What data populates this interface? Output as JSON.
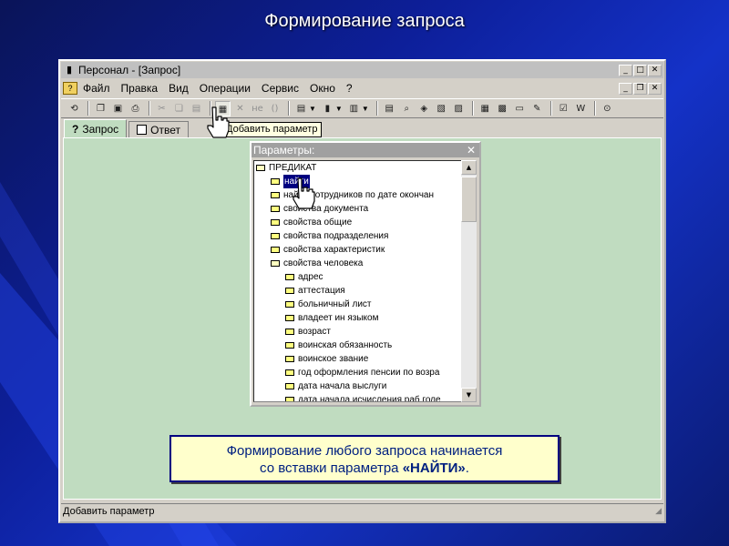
{
  "slide": {
    "title": "Формирование запроса"
  },
  "window": {
    "title": "Персонал - [Запрос]",
    "controls": {
      "minimize": "_",
      "maximize": "□",
      "close": "✕"
    },
    "mdi_controls": {
      "minimize": "_",
      "restore": "❐",
      "close": "✕"
    }
  },
  "menu": [
    "Файл",
    "Правка",
    "Вид",
    "Операции",
    "Сервис",
    "Окно",
    "?"
  ],
  "toolbar": {
    "tooltip": "Добавить параметр",
    "disabled_labels": {
      "ne": "не",
      "brackets": "()"
    }
  },
  "tabs": [
    {
      "label": "Запрос",
      "active": true,
      "icon": "question-icon"
    },
    {
      "label": "Ответ",
      "active": false,
      "icon": "checkbox-icon"
    }
  ],
  "params_dialog": {
    "title": "Параметры:",
    "close": "✕",
    "tree": [
      {
        "label": "ПРЕДИКАТ",
        "level": 0,
        "open": true
      },
      {
        "label": "найти",
        "level": 1,
        "selected": true
      },
      {
        "label": "найти сотрудников по дате окончан",
        "level": 1
      },
      {
        "label": "свойства документа",
        "level": 1
      },
      {
        "label": "свойства общие",
        "level": 1
      },
      {
        "label": "свойства подразделения",
        "level": 1
      },
      {
        "label": "свойства характеристик",
        "level": 1
      },
      {
        "label": "свойства человека",
        "level": 1,
        "open": true
      },
      {
        "label": "адрес",
        "level": 2
      },
      {
        "label": "аттестация",
        "level": 2
      },
      {
        "label": "больничный лист",
        "level": 2
      },
      {
        "label": "владеет ин языком",
        "level": 2
      },
      {
        "label": "возраст",
        "level": 2
      },
      {
        "label": "воинская обязанность",
        "level": 2
      },
      {
        "label": "воинское звание",
        "level": 2
      },
      {
        "label": "год оформления пенсии по возра",
        "level": 2
      },
      {
        "label": "дата начала выслуги",
        "level": 2
      },
      {
        "label": "дата начала исчисления раб.голе",
        "level": 2
      }
    ]
  },
  "callout": {
    "line1": "Формирование любого запроса начинается",
    "line2_prefix": "со вставки параметра ",
    "line2_bold": "«НАЙТИ»",
    "line2_suffix": "."
  },
  "statusbar": {
    "text": "Добавить параметр"
  },
  "colors": {
    "client_bg": "#c0dcc0",
    "callout_bg": "#ffffcc",
    "callout_text": "#002080"
  }
}
